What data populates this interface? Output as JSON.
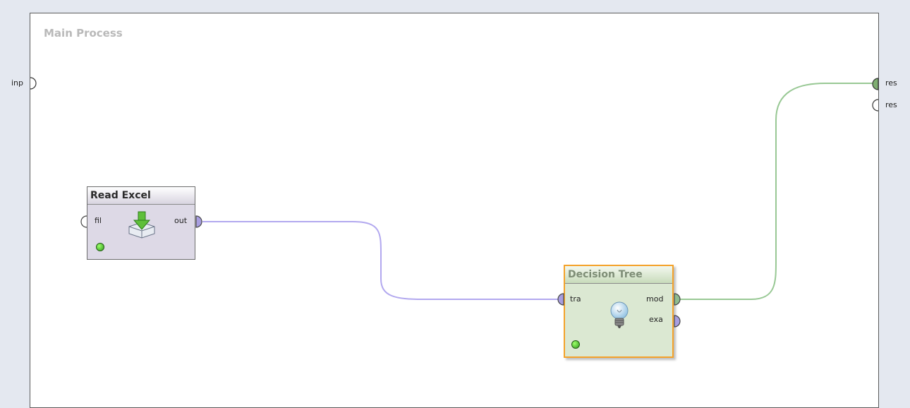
{
  "process": {
    "title": "Main Process"
  },
  "outer_ports": {
    "input": {
      "label": "inp"
    },
    "results": [
      {
        "label": "res",
        "connected": true
      },
      {
        "label": "res",
        "connected": false
      }
    ]
  },
  "operators": [
    {
      "title": "Read Excel",
      "inputs": [
        "fil"
      ],
      "outputs": [
        "out"
      ],
      "icon": "excel-import-icon",
      "status_color": "#3aa320"
    },
    {
      "title": "Decision Tree",
      "inputs": [
        "tra"
      ],
      "outputs": [
        "mod",
        "exa"
      ],
      "icon": "lightbulb-icon",
      "status_color": "#3aa320",
      "selected": true
    }
  ],
  "colors": {
    "example_set_port": "#a89ee0",
    "model_port": "#8fbc8f",
    "wire_example_set": "#b2a8ef",
    "wire_model": "#98c894",
    "selection_border": "#f4a22a"
  }
}
